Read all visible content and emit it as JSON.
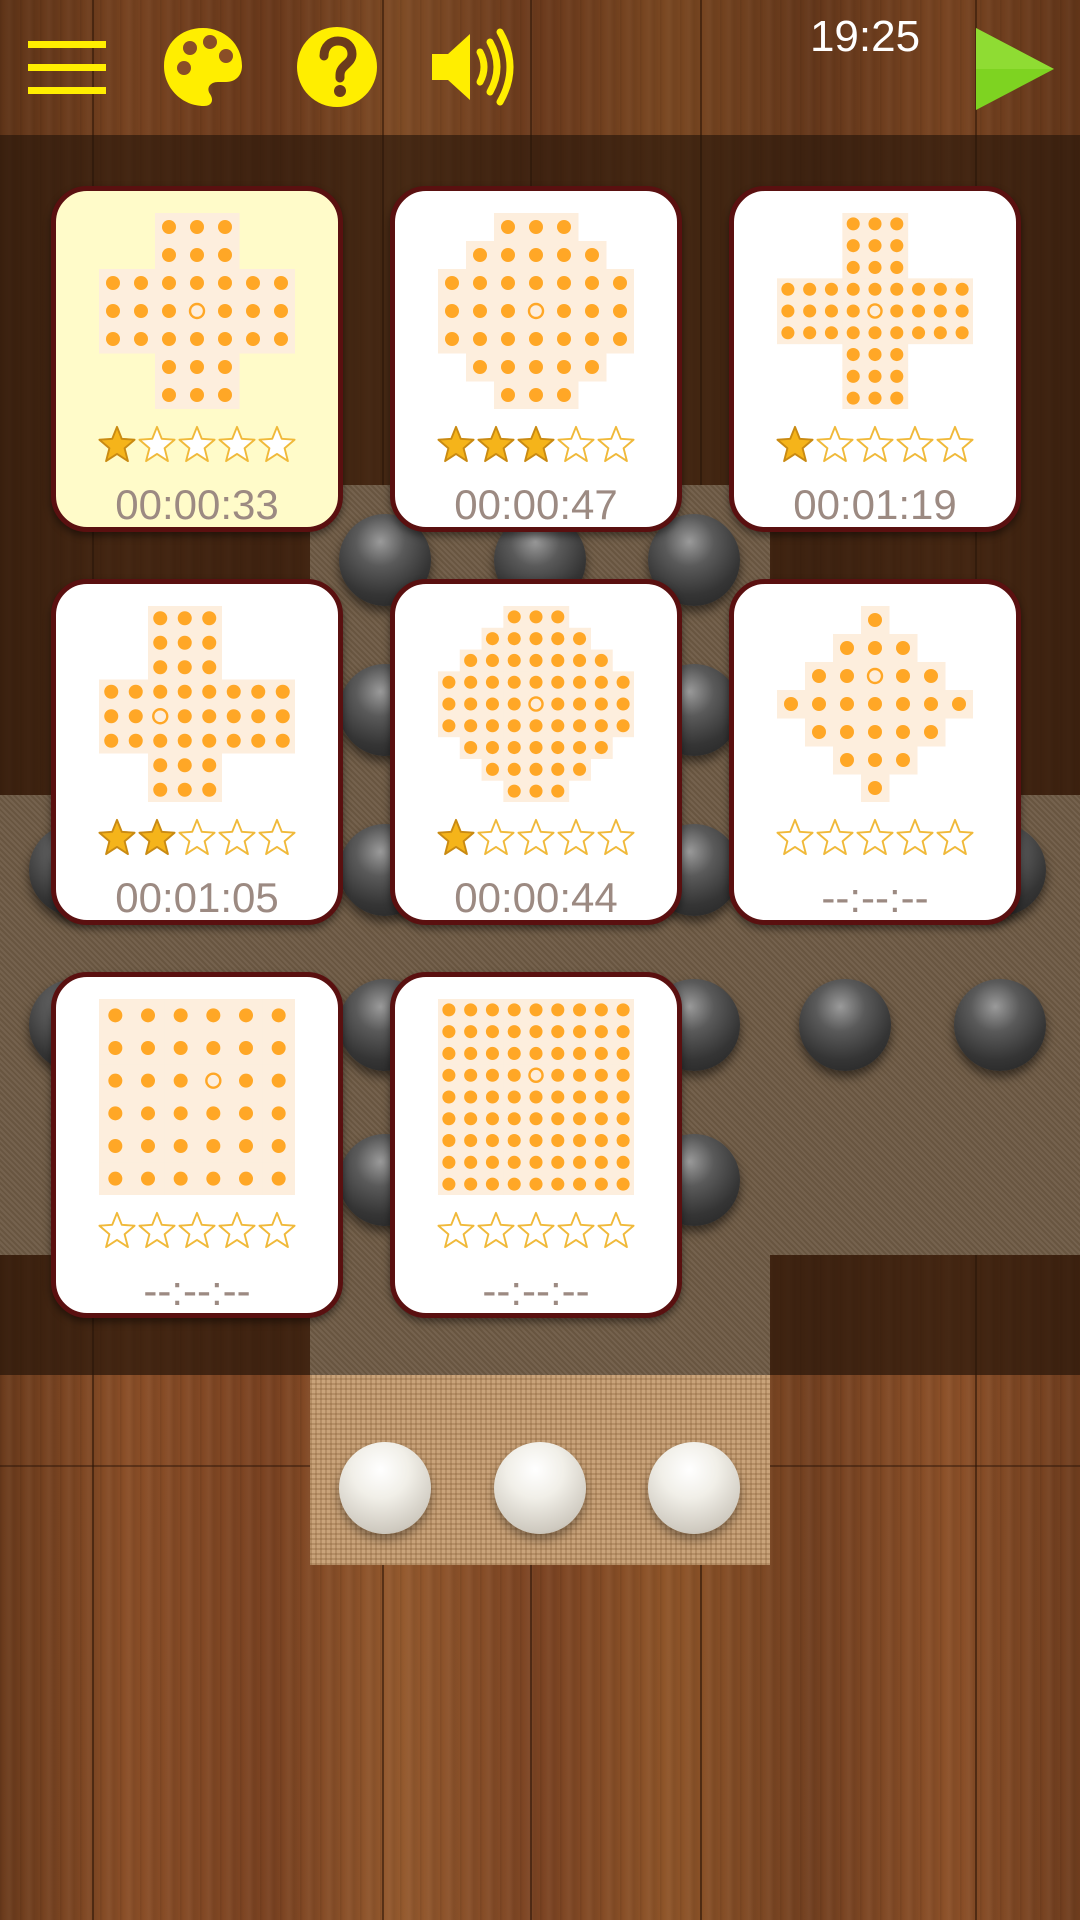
{
  "header": {
    "clock": "19:25",
    "buttons": [
      {
        "name": "menu-button",
        "icon": "hamburger-menu-icon"
      },
      {
        "name": "theme-button",
        "icon": "palette-icon"
      },
      {
        "name": "help-button",
        "icon": "question-icon"
      },
      {
        "name": "sound-button",
        "icon": "speaker-icon"
      },
      {
        "name": "play-button",
        "icon": "play-icon"
      }
    ]
  },
  "colors": {
    "icon_yellow": "#ffee00",
    "play_green": "#7ed321",
    "star_filled": "#f5b41a",
    "star_empty_outline": "#f0b93a",
    "peg": "#ffa726",
    "card_border": "#5a1010",
    "selected_card": "#fffbc9"
  },
  "levels": [
    {
      "shape": "french-cross-7",
      "stars": 1,
      "time": "00:00:33",
      "selected": true
    },
    {
      "shape": "octagon-7",
      "stars": 3,
      "time": "00:00:47",
      "selected": false
    },
    {
      "shape": "cross-9",
      "stars": 1,
      "time": "00:01:19",
      "selected": false
    },
    {
      "shape": "offset-cross-8",
      "stars": 2,
      "time": "00:01:05",
      "selected": false
    },
    {
      "shape": "diamond-9",
      "stars": 1,
      "time": "00:00:44",
      "selected": false
    },
    {
      "shape": "diamond-7",
      "stars": 0,
      "time": "--:--:--",
      "selected": false
    },
    {
      "shape": "square-6",
      "stars": 0,
      "time": "--:--:--",
      "selected": false
    },
    {
      "shape": "square-9",
      "stars": 0,
      "time": "--:--:--",
      "selected": false
    }
  ]
}
